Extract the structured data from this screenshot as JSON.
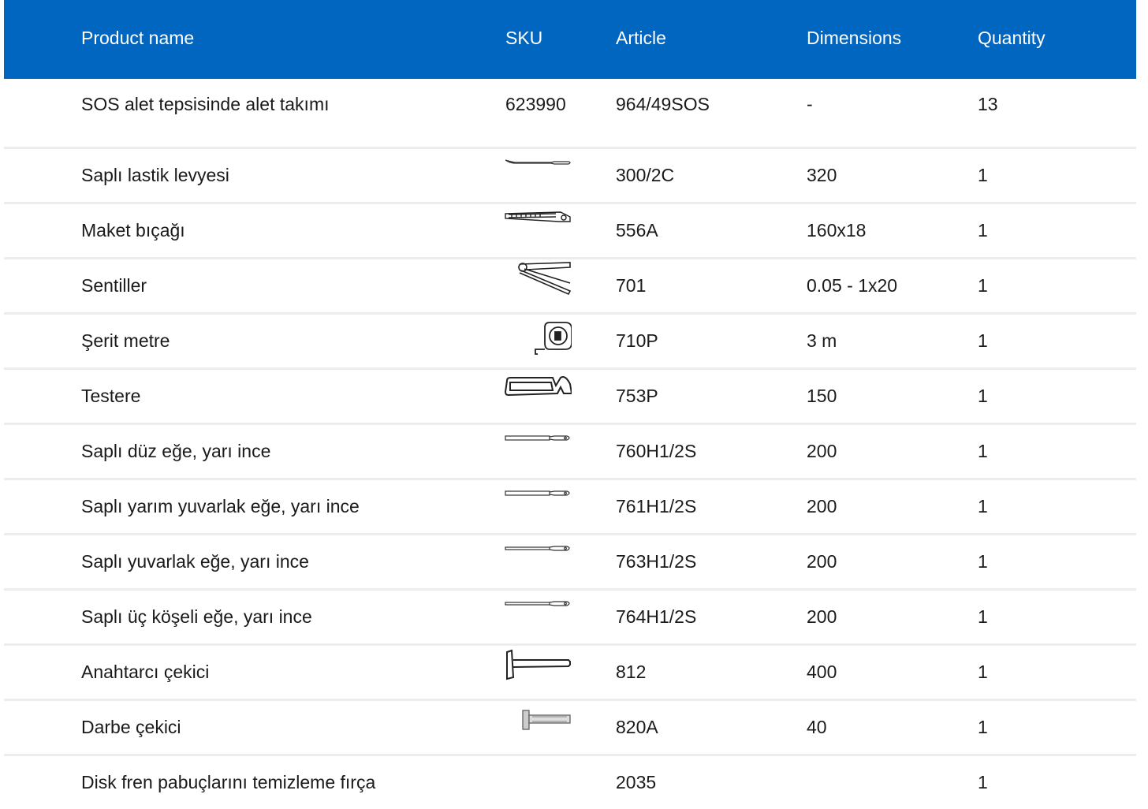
{
  "header": {
    "product_name": "Product name",
    "sku": "SKU",
    "article": "Article",
    "dimensions": "Dimensions",
    "quantity": "Quantity"
  },
  "rows": [
    {
      "name": "SOS alet tepsisinde alet takımı",
      "sku": "623990",
      "article": "964/49SOS",
      "dimensions": "-",
      "quantity": "13",
      "icon": "none"
    },
    {
      "name": "Saplı lastik levyesi",
      "sku": "",
      "article": "300/2C",
      "dimensions": "320",
      "quantity": "1",
      "icon": "tire-lever-icon"
    },
    {
      "name": "Maket bıçağı",
      "sku": "",
      "article": "556A",
      "dimensions": "160x18",
      "quantity": "1",
      "icon": "utility-knife-icon"
    },
    {
      "name": "Sentiller",
      "sku": "",
      "article": "701",
      "dimensions": "0.05 - 1x20",
      "quantity": "1",
      "icon": "feeler-gauge-icon"
    },
    {
      "name": "Şerit metre",
      "sku": "",
      "article": "710P",
      "dimensions": "3 m",
      "quantity": "1",
      "icon": "tape-measure-icon"
    },
    {
      "name": "Testere",
      "sku": "",
      "article": "753P",
      "dimensions": "150",
      "quantity": "1",
      "icon": "hacksaw-icon"
    },
    {
      "name": "Saplı düz eğe, yarı ince",
      "sku": "",
      "article": "760H1/2S",
      "dimensions": "200",
      "quantity": "1",
      "icon": "flat-file-icon"
    },
    {
      "name": "Saplı yarım yuvarlak eğe, yarı ince",
      "sku": "",
      "article": "761H1/2S",
      "dimensions": "200",
      "quantity": "1",
      "icon": "half-round-file-icon"
    },
    {
      "name": "Saplı yuvarlak eğe, yarı ince",
      "sku": "",
      "article": "763H1/2S",
      "dimensions": "200",
      "quantity": "1",
      "icon": "round-file-icon"
    },
    {
      "name": "Saplı üç köşeli eğe, yarı ince",
      "sku": "",
      "article": "764H1/2S",
      "dimensions": "200",
      "quantity": "1",
      "icon": "triangular-file-icon"
    },
    {
      "name": "Anahtarcı çekici",
      "sku": "",
      "article": "812",
      "dimensions": "400",
      "quantity": "1",
      "icon": "machinist-hammer-icon"
    },
    {
      "name": "Darbe çekici",
      "sku": "",
      "article": "820A",
      "dimensions": "40",
      "quantity": "1",
      "icon": "dead-blow-hammer-icon"
    },
    {
      "name": "Disk fren pabuçlarını temizleme fırça",
      "sku": "",
      "article": "2035",
      "dimensions": "",
      "quantity": "1",
      "icon": "none"
    }
  ],
  "colors": {
    "header_bg": "#0066bf",
    "header_text": "#ffffff",
    "divider": "#ededed"
  }
}
